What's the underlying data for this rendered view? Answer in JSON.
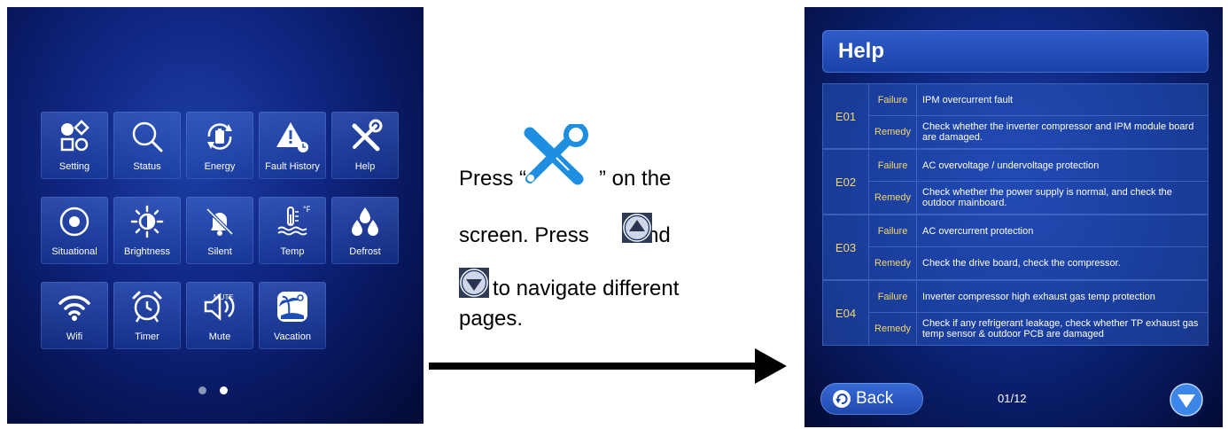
{
  "left_screen": {
    "tiles": [
      {
        "label": "Setting",
        "icon": "setting-icon"
      },
      {
        "label": "Status",
        "icon": "search-icon"
      },
      {
        "label": "Energy",
        "icon": "energy-icon"
      },
      {
        "label": "Fault History",
        "icon": "warning-icon"
      },
      {
        "label": "Help",
        "icon": "tools-icon"
      },
      {
        "label": "Situational",
        "icon": "situational-icon"
      },
      {
        "label": "Brightness",
        "icon": "sun-icon"
      },
      {
        "label": "Silent",
        "icon": "bell-off-icon"
      },
      {
        "label": "Temp",
        "icon": "thermometer-icon",
        "unit": "°F"
      },
      {
        "label": "Defrost",
        "icon": "drops-icon"
      },
      {
        "label": "Wifi",
        "icon": "wifi-icon"
      },
      {
        "label": "Timer",
        "icon": "alarm-clock-icon"
      },
      {
        "label": "Mute",
        "icon": "speaker-mute-icon",
        "badge": "MUTE"
      },
      {
        "label": "Vacation",
        "icon": "island-icon"
      }
    ],
    "page_dots": {
      "count": 2,
      "active": 2
    }
  },
  "instructions": {
    "line1_a": "Press “",
    "line1_b": "” on the",
    "line2_a": "screen. Press",
    "line2_b": "and",
    "line3": "to navigate different",
    "line4": "pages."
  },
  "help_screen": {
    "title": "Help",
    "errors": [
      {
        "code": "E01",
        "failure_tag": "Failure",
        "failure": "IPM overcurrent fault",
        "remedy_tag": "Remedy",
        "remedy": "Check whether the inverter compressor and IPM module board are damaged."
      },
      {
        "code": "E02",
        "failure_tag": "Failure",
        "failure": "AC overvoltage / undervoltage protection",
        "remedy_tag": "Remedy",
        "remedy": "Check whether the power supply is normal, and check the outdoor mainboard."
      },
      {
        "code": "E03",
        "failure_tag": "Failure",
        "failure": "AC overcurrent protection",
        "remedy_tag": "Remedy",
        "remedy": "Check the drive board, check the compressor."
      },
      {
        "code": "E04",
        "failure_tag": "Failure",
        "failure": "Inverter compressor high exhaust gas temp protection",
        "remedy_tag": "Remedy",
        "remedy": "Check if any refrigerant leakage, check whether TP exhaust gas temp sensor & outdoor PCB are damaged"
      }
    ],
    "back_label": "Back",
    "page_indicator": "01/12"
  },
  "colors": {
    "tag_yellow": "#f4d76b",
    "dot_active": "#ffffff",
    "dot_inactive": "#8a97b8",
    "tool_blue": "#1e8ee0"
  }
}
